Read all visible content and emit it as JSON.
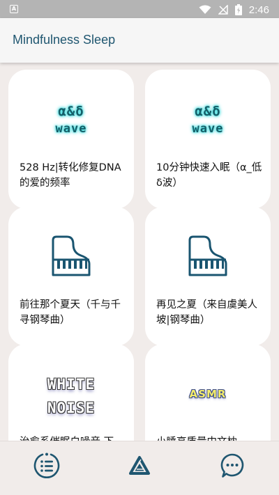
{
  "status_bar": {
    "time": "2:46",
    "notification_icon": "app-notification-icon"
  },
  "app_bar": {
    "title": "Mindfulness Sleep"
  },
  "cards": [
    {
      "art_type": "wave",
      "art_lines": [
        "α&δ",
        "wave"
      ],
      "title": "528 Hz|转化修复DNA的爱的频率"
    },
    {
      "art_type": "wave",
      "art_lines": [
        "α&δ",
        "wave"
      ],
      "title": "10分钟快速入眠（α_低δ波）"
    },
    {
      "art_type": "piano",
      "icon": "grand-piano-icon",
      "title": "前往那个夏天（千与千寻钢琴曲）"
    },
    {
      "art_type": "piano",
      "icon": "grand-piano-icon",
      "title": "再见之夏（来自虞美人坡|钢琴曲）"
    },
    {
      "art_type": "noise",
      "art_lines": [
        "WHITE",
        "NOISE"
      ],
      "title": "治愈系催眠白噪音 下"
    },
    {
      "art_type": "asmr",
      "art_lines": [
        "ASMR"
      ],
      "title": "小睡高质量中文枕"
    }
  ],
  "bottom_nav": [
    {
      "name": "list",
      "icon": "list-menu-icon"
    },
    {
      "name": "explore",
      "icon": "triangle-logo-icon"
    },
    {
      "name": "chat",
      "icon": "chat-bubble-icon"
    }
  ],
  "colors": {
    "accent": "#1f5670",
    "background": "#f1ecea",
    "status_bar": "#b4b4b4",
    "glow": "#50e3e3"
  }
}
